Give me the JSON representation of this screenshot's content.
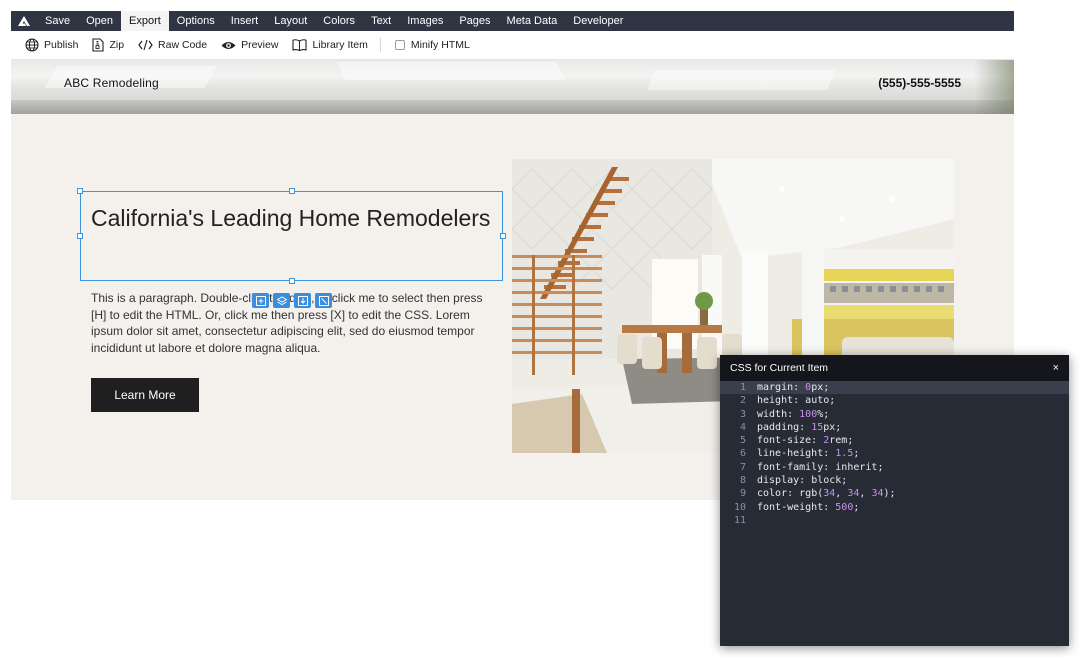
{
  "menubar": {
    "items": [
      "Save",
      "Open",
      "Export",
      "Options",
      "Insert",
      "Layout",
      "Colors",
      "Text",
      "Images",
      "Pages",
      "Meta Data",
      "Developer"
    ],
    "active": "Export"
  },
  "toolbar": {
    "publish": "Publish",
    "zip": "Zip",
    "raw_code": "Raw Code",
    "preview": "Preview",
    "library_item": "Library Item",
    "minify_html": "Minify HTML"
  },
  "site": {
    "brand": "ABC Remodeling",
    "phone": "(555)-555-5555",
    "headline": "California's Leading Home Remodelers",
    "paragraph": "This is a paragraph. Double-click to edit it, or click me to select then press [H] to edit the HTML. Or, click me then press [X] to edit the CSS. Lorem ipsum dolor sit amet, consectetur adipiscing elit, sed do eiusmod tempor incididunt ut labore et dolore magna aliqua.",
    "cta": "Learn More"
  },
  "css_panel": {
    "title": "CSS for Current Item",
    "close": "×",
    "lines": [
      {
        "n": "1",
        "p": "margin",
        "v": "0px"
      },
      {
        "n": "2",
        "p": "height",
        "v": "auto"
      },
      {
        "n": "3",
        "p": "width",
        "v": "100%"
      },
      {
        "n": "4",
        "p": "padding",
        "v": "15px"
      },
      {
        "n": "5",
        "p": "font-size",
        "v": "2rem"
      },
      {
        "n": "6",
        "p": "line-height",
        "v": "1.5"
      },
      {
        "n": "7",
        "p": "font-family",
        "v": "inherit"
      },
      {
        "n": "8",
        "p": "display",
        "v": "block"
      },
      {
        "n": "9",
        "p": "color",
        "v": "rgb(34, 34, 34)"
      },
      {
        "n": "10",
        "p": "font-weight",
        "v": "500"
      },
      {
        "n": "11",
        "p": "",
        "v": ""
      }
    ]
  },
  "colors": {
    "menubar": "#2f3542",
    "selection": "#3a94e0",
    "code_bg": "#272b36",
    "number": "#c792ea"
  }
}
